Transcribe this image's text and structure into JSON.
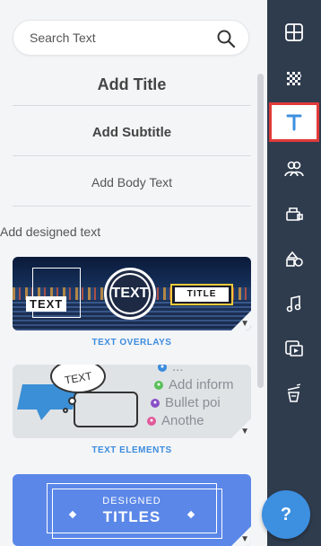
{
  "search": {
    "placeholder": "Search Text"
  },
  "text_options": {
    "title": "Add Title",
    "subtitle": "Add Subtitle",
    "body": "Add Body Text"
  },
  "designed": {
    "section_label": "Add designed text",
    "overlays": {
      "caption": "TEXT OVERLAYS",
      "sample_box": "TEXT",
      "sample_circle": "TEXT",
      "sample_title": "TITLE"
    },
    "elements": {
      "caption": "TEXT ELEMENTS",
      "sample_bubble": "TEXT",
      "lines": [
        "...",
        "Add inform",
        "Bullet poi",
        "Anothe"
      ]
    },
    "titles": {
      "small": "DESIGNED",
      "big": "TITLES"
    }
  },
  "rail": {
    "items": [
      {
        "icon": "layout-icon"
      },
      {
        "icon": "background-icon"
      },
      {
        "icon": "text-icon",
        "active": true
      },
      {
        "icon": "people-icon"
      },
      {
        "icon": "objects-icon"
      },
      {
        "icon": "shapes-icon"
      },
      {
        "icon": "music-icon"
      },
      {
        "icon": "video-icon"
      },
      {
        "icon": "magic-icon"
      }
    ],
    "help_label": "?"
  },
  "colors": {
    "accent": "#3c8cde",
    "rail": "#2f3c4e",
    "active_border": "#e23a3a"
  }
}
